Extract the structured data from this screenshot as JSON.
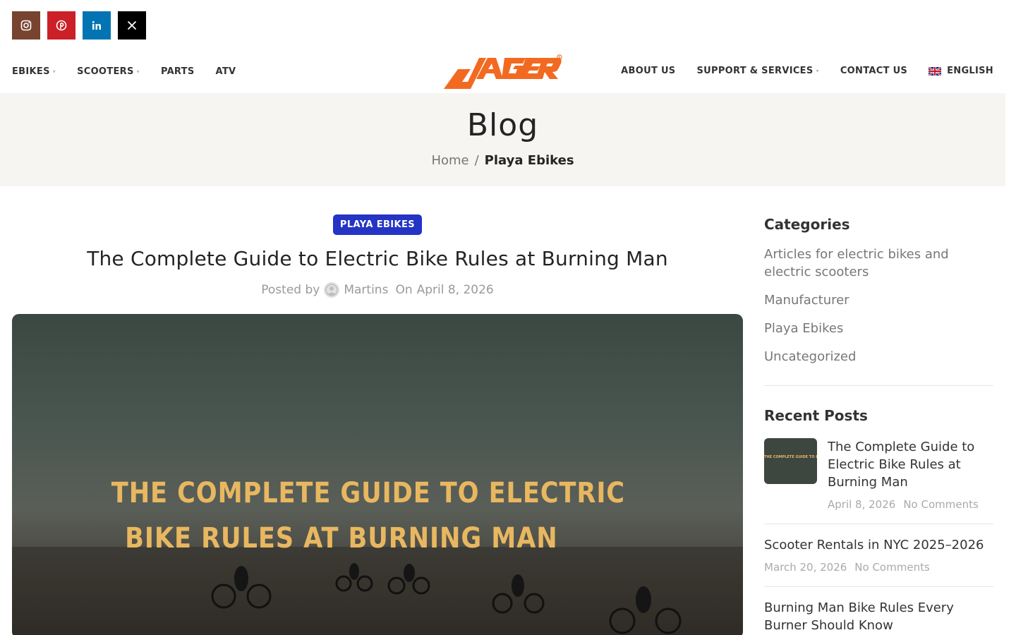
{
  "social": [
    {
      "name": "instagram-icon",
      "glyph": "◎"
    },
    {
      "name": "pinterest-icon",
      "glyph": "P"
    },
    {
      "name": "linkedin-icon",
      "glyph": "in"
    },
    {
      "name": "x-icon",
      "glyph": "✕"
    }
  ],
  "nav": {
    "left": [
      {
        "label": "EBIKES",
        "dropdown": true
      },
      {
        "label": "SCOOTERS",
        "dropdown": true
      },
      {
        "label": "PARTS",
        "dropdown": false
      },
      {
        "label": "ATV",
        "dropdown": false
      }
    ],
    "right": [
      {
        "label": "ABOUT US",
        "dropdown": false
      },
      {
        "label": "SUPPORT & SERVICES",
        "dropdown": true
      },
      {
        "label": "CONTACT US",
        "dropdown": false
      }
    ],
    "language": "ENGLISH",
    "caret": "▾",
    "logo_text": "JAGER"
  },
  "page": {
    "title": "Blog",
    "breadcrumb_home": "Home",
    "breadcrumb_sep": "/",
    "breadcrumb_current": "Playa Ebikes"
  },
  "post": {
    "category": "PLAYA EBIKES",
    "title": "The Complete Guide to Electric Bike Rules at Burning Man",
    "posted_by": "Posted by",
    "author": "Martins",
    "date_prefix": "On",
    "date": "April 8, 2026",
    "hero_line1": "THE COMPLETE GUIDE TO ELECTRIC",
    "hero_line2": "BIKE RULES AT BURNING MAN"
  },
  "sidebar": {
    "categories_title": "Categories",
    "categories": [
      "Articles for electric bikes and electric scooters",
      "Manufacturer",
      "Playa Ebikes",
      "Uncategorized"
    ],
    "recent_title": "Recent Posts",
    "recent": [
      {
        "title": "The Complete Guide to Electric Bike Rules at Burning Man",
        "date": "April 8, 2026",
        "comments": "No Comments",
        "thumb": "THE COMPLETE GUIDE TO ELECTRIC"
      },
      {
        "title": "Scooter Rentals in NYC 2025–2026",
        "date": "March 20, 2026",
        "comments": "No Comments"
      },
      {
        "title": "Burning Man Bike Rules Every Burner Should Know",
        "date": "",
        "comments": ""
      }
    ]
  },
  "colors": {
    "badge": "#2434c4",
    "logo": "#f26a21",
    "hero_text": "#e8b760"
  }
}
